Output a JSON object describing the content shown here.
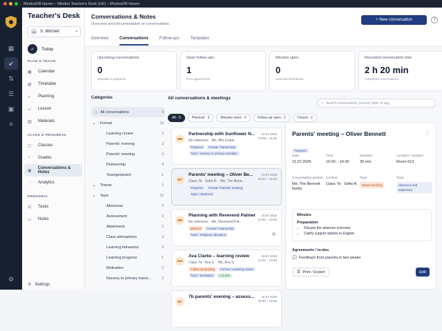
{
  "window": {
    "title": "MindooDB Haven – Mindoo Teacher's Desk (UK) – MindooDB Haven"
  },
  "sidebar": {
    "brand": "Teacher's Desk",
    "user": {
      "initials": "SM",
      "name": "S. Mitchell"
    },
    "today": "Today",
    "sections": [
      {
        "title": "PLAN & TEACH",
        "items": [
          "Calendar",
          "Timetable",
          "Planning",
          "Lesson",
          "Materials"
        ]
      },
      {
        "title": "CLASS & PROGRESS",
        "items": [
          "Classes",
          "Grades",
          "Conversations & Notes",
          "Analytics"
        ]
      },
      {
        "title": "PERSONAL",
        "items": [
          "Tasks",
          "Notes"
        ]
      }
    ],
    "settings": "Settings"
  },
  "header": {
    "title": "Conversations & Notes",
    "subtitle": "Overview and documentation of conversations.",
    "new_button": "+ New conversation",
    "tabs": [
      "Overview",
      "Conversations",
      "Follow-ups",
      "Templates"
    ]
  },
  "stats": [
    {
      "label": "Upcoming conversations",
      "value": "0",
      "sub": "planned or prepared"
    },
    {
      "label": "Open follow-ups",
      "value": "1",
      "sub": "from agreements"
    },
    {
      "label": "Minutes open",
      "value": "0",
      "sub": "need documentation"
    },
    {
      "label": "Recorded conversation time",
      "value": "2 h 20 min",
      "sub": "completed conversations"
    }
  ],
  "categories": {
    "title": "Categories",
    "all": {
      "label": "All conversations",
      "count": "5"
    },
    "rows": [
      {
        "type": "grp",
        "label": "Format",
        "count": "13"
      },
      {
        "type": "sub",
        "label": "Learning review",
        "count": "2"
      },
      {
        "type": "sub",
        "label": "Parents' evening",
        "count": "3"
      },
      {
        "type": "sub",
        "label": "Parents' meeting",
        "count": "3"
      },
      {
        "type": "sub",
        "label": "Partnership",
        "count": "4"
      },
      {
        "type": "sub",
        "label": "Teamgespräch",
        "count": "1"
      },
      {
        "type": "grp",
        "label": "Theme",
        "count": "2"
      },
      {
        "type": "grp",
        "label": "Topic",
        "count": "12"
      },
      {
        "type": "sub",
        "label": "Absences",
        "count": "2"
      },
      {
        "type": "sub",
        "label": "Assessment",
        "count": "2"
      },
      {
        "type": "sub",
        "label": "Attainment",
        "count": "2"
      },
      {
        "type": "sub",
        "label": "Class atmosphere",
        "count": "3"
      },
      {
        "type": "sub",
        "label": "Learning behaviour",
        "count": "3"
      },
      {
        "type": "sub",
        "label": "Learning progress",
        "count": "1"
      },
      {
        "type": "sub",
        "label": "Motivation",
        "count": "2"
      },
      {
        "type": "sub",
        "label": "Nursery to primary transi...",
        "count": "2"
      }
    ]
  },
  "list": {
    "title": "All conversations & meetings",
    "search_placeholder": "Search conversation, person, topic or tag...",
    "filters": [
      "All · 5",
      "Planned · 2",
      "Minutes open · 0",
      "Follow-up open · 1",
      "Closed · 2"
    ],
    "cards": [
      {
        "initials": "MM",
        "title": "Partnership with Sunflower N...",
        "meta": "No reference · Me, Mrs Foster",
        "date": "24.07.2026",
        "time": "10:00 – 11:40",
        "tags": [
          {
            "t": "Prepared",
            "c": ""
          },
          {
            "t": "Format / Partnership",
            "c": ""
          },
          {
            "t": "Topic / Nursery to primary transition",
            "c": ""
          }
        ]
      },
      {
        "initials": "MT",
        "title": "Parents' meeting – Oliver Be...",
        "meta": "Class 7b · Sofia R. · Me, The Benn...",
        "date": "21.07.2026",
        "time": "16:00 – 16:30",
        "tags": [
          {
            "t": "Prepared",
            "c": ""
          },
          {
            "t": "Format / Parents' meeting",
            "c": ""
          },
          {
            "t": "Topic / Absences",
            "c": ""
          }
        ]
      },
      {
        "initials": "MR",
        "title": "Planning with Reverend Palmer",
        "meta": "No reference · Me, Reverend Pal...",
        "date": "19.07.2026",
        "time": "12:00 – 13:00",
        "tags": [
          {
            "t": "Minuted",
            "c": "warn"
          },
          {
            "t": "Format / Partnership",
            "c": ""
          },
          {
            "t": "Topic / Religious education",
            "c": ""
          }
        ]
      },
      {
        "initials": "AVA",
        "title": "Ava Clarke – learning review",
        "meta": "Class 7a · Ava S. · Me, Ava S.",
        "date": "16.07.2026",
        "time": "10:20 – 10:40",
        "tags": [
          {
            "t": "Follow-up pending",
            "c": "warn"
          },
          {
            "t": "Format / Learning review",
            "c": ""
          },
          {
            "t": "Topic / Motivation",
            "c": ""
          },
          {
            "t": "1 to-dos",
            "c": "grn"
          }
        ]
      },
      {
        "initials": "M7",
        "title": "7b parents' evening – assess...",
        "meta": "",
        "date": "15.07.2026",
        "time": "18:30 – 19:30",
        "tags": []
      }
    ]
  },
  "detail": {
    "title": "Parents' meeting – Oliver Bennett",
    "status": "Prepared",
    "fields": [
      {
        "label": "Date",
        "value": "21.07.2026"
      },
      {
        "label": "Time",
        "value": "16:00 – 16:30"
      },
      {
        "label": "Duration",
        "value": "30 min"
      },
      {
        "label": "Location / medium",
        "value": "Room 012"
      },
      {
        "label": "Conversation partner",
        "value": "Me, The Bennett family"
      },
      {
        "label": "Context",
        "value": "Class 7b · Sofia R."
      },
      {
        "label": "Type",
        "value": "Parent meeting"
      },
      {
        "label": "Topic",
        "value": "Absences and attainment"
      }
    ],
    "minutes_title": "Minutes",
    "preparation_title": "Preparation",
    "preparation": [
      "Discuss the absence overview",
      "Clarify support options in English"
    ],
    "todos_title": "Agreements / to-dos",
    "todo": "Feedback from parents in two weeks",
    "print_button": "Print / Export",
    "edit_button": "Edit"
  }
}
